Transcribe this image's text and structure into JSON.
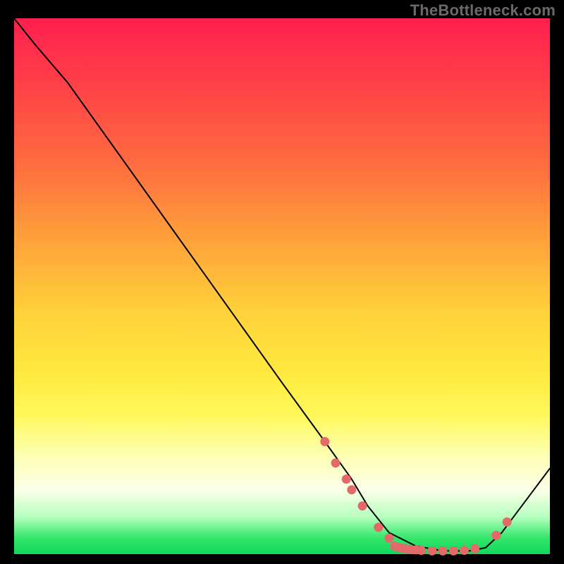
{
  "watermark": "TheBottleneck.com",
  "colors": {
    "gradient_top": "#ff1f4f",
    "gradient_mid_orange": "#ffa43a",
    "gradient_mid_yellow": "#ffe93e",
    "gradient_pale": "#fbffe8",
    "gradient_bottom": "#0fd85b",
    "curve": "#000000",
    "dot": "#e46a6a",
    "background": "#000000"
  },
  "chart_data": {
    "type": "line",
    "title": "",
    "xlabel": "",
    "ylabel": "",
    "xlim": [
      0,
      100
    ],
    "ylim": [
      0,
      100
    ],
    "grid": false,
    "legend": false,
    "series": [
      {
        "name": "bottleneck-curve",
        "x": [
          0,
          4,
          10,
          20,
          30,
          40,
          50,
          58,
          63,
          66,
          70,
          75,
          80,
          85,
          88,
          91,
          94,
          97,
          100
        ],
        "y": [
          100,
          95,
          88,
          74,
          60,
          46,
          32,
          21,
          14,
          9,
          4,
          1.5,
          0.6,
          0.6,
          1.2,
          4,
          8,
          12,
          16
        ]
      }
    ],
    "markers": [
      {
        "x": 58,
        "y": 21
      },
      {
        "x": 60,
        "y": 17
      },
      {
        "x": 62,
        "y": 14
      },
      {
        "x": 63,
        "y": 12
      },
      {
        "x": 65,
        "y": 9
      },
      {
        "x": 68,
        "y": 5
      },
      {
        "x": 70,
        "y": 3
      },
      {
        "x": 71,
        "y": 1.5
      },
      {
        "x": 72,
        "y": 1.2
      },
      {
        "x": 73,
        "y": 1.0
      },
      {
        "x": 74,
        "y": 0.9
      },
      {
        "x": 75,
        "y": 0.8
      },
      {
        "x": 76,
        "y": 0.7
      },
      {
        "x": 78,
        "y": 0.6
      },
      {
        "x": 80,
        "y": 0.6
      },
      {
        "x": 82,
        "y": 0.6
      },
      {
        "x": 84,
        "y": 0.7
      },
      {
        "x": 86,
        "y": 1.0
      },
      {
        "x": 90,
        "y": 3.5
      },
      {
        "x": 92,
        "y": 6
      }
    ]
  }
}
